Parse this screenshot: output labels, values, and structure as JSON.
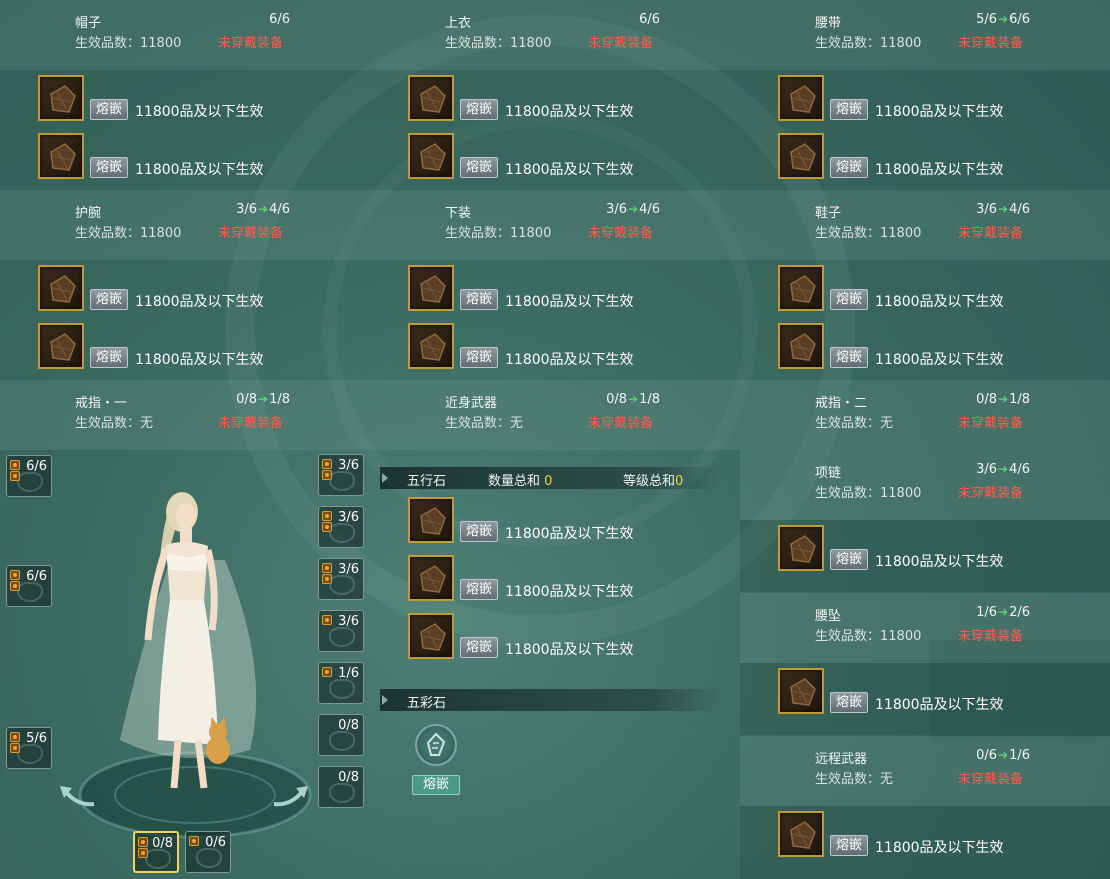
{
  "colors": {
    "status_red": "#ff5b4f",
    "arrow_green": "#5fcf7a",
    "gold_border": "#c29a34",
    "sum_yellow": "#f0d24a"
  },
  "labels": {
    "grade_label": "生效品数：",
    "status": "未穿戴装备",
    "arrow": "➔",
    "inlay_button": "熔嵌",
    "gem_desc": "11800品及以下生效"
  },
  "slots": [
    {
      "name": "帽子",
      "count": "6/6",
      "next": "",
      "grade": "11800"
    },
    {
      "name": "上衣",
      "count": "6/6",
      "next": "",
      "grade": "11800"
    },
    {
      "name": "腰带",
      "count": "5/6",
      "next": "6/6",
      "grade": "11800"
    },
    {
      "name": "护腕",
      "count": "3/6",
      "next": "4/6",
      "grade": "11800"
    },
    {
      "name": "下装",
      "count": "3/6",
      "next": "4/6",
      "grade": "11800"
    },
    {
      "name": "鞋子",
      "count": "3/6",
      "next": "4/6",
      "grade": "11800"
    },
    {
      "name": "戒指・一",
      "count": "0/8",
      "next": "1/8",
      "grade": "无"
    },
    {
      "name": "近身武器",
      "count": "0/8",
      "next": "1/8",
      "grade": "无"
    },
    {
      "name": "戒指・二",
      "count": "0/8",
      "next": "1/8",
      "grade": "无"
    },
    {
      "name": "项链",
      "count": "3/6",
      "next": "4/6",
      "grade": "11800"
    },
    {
      "name": "腰坠",
      "count": "1/6",
      "next": "2/6",
      "grade": "11800"
    },
    {
      "name": "远程武器",
      "count": "0/6",
      "next": "1/6",
      "grade": "无"
    }
  ],
  "wuxing": {
    "title": "五行石",
    "quantity_label": "数量总和",
    "quantity_value": "0",
    "level_label": "等级总和",
    "level_value": "0"
  },
  "wucai": {
    "title": "五彩石",
    "button": "熔嵌"
  },
  "left_slots": [
    "6/6",
    "6/6",
    "5/6"
  ],
  "right_slots": [
    "3/6",
    "3/6",
    "3/6",
    "3/6",
    "1/6",
    "0/8",
    "0/8"
  ],
  "bottom_slots": [
    "0/8",
    "0/6"
  ]
}
